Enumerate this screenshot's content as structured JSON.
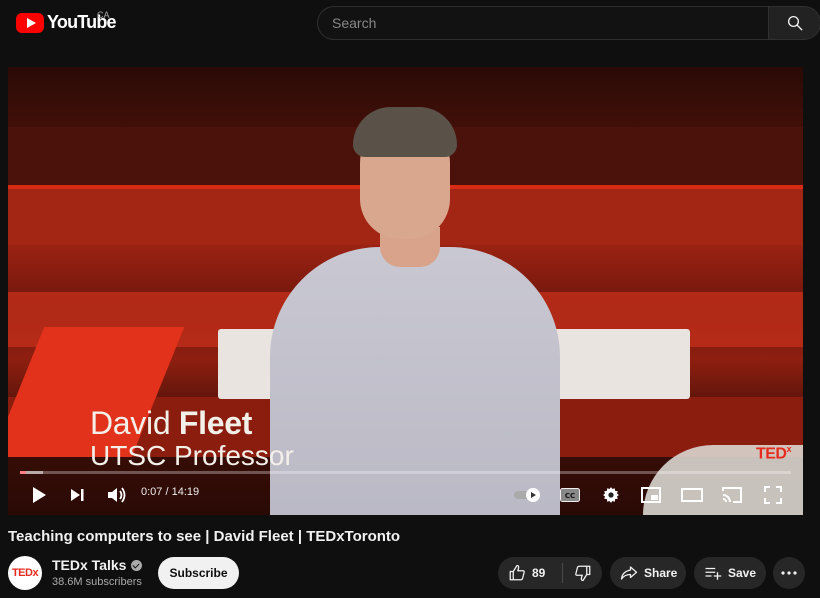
{
  "header": {
    "logo_text": "YouTube",
    "country_code": "CA",
    "search_placeholder": "Search",
    "search_icon": "search-icon"
  },
  "player": {
    "lower_third_first": "David",
    "lower_third_last": "Fleet",
    "lower_third_title": "UTSC Professor",
    "watermark": "TED",
    "watermark_sup": "x",
    "current_time": "0:07",
    "duration": "14:19",
    "time_display": "0:07 / 14:19",
    "progress_fraction": 0.008,
    "buffered_fraction": 0.03,
    "icons": [
      "play-icon",
      "next-icon",
      "volume-icon",
      "autoplay-toggle-icon",
      "captions-icon",
      "settings-icon",
      "miniplayer-icon",
      "theater-icon",
      "cast-icon",
      "fullscreen-icon"
    ],
    "accent_color": "#ff0000"
  },
  "video": {
    "title": "Teaching computers to see | David Fleet | TEDxToronto"
  },
  "channel": {
    "avatar_text": "TEDx",
    "name": "TEDx Talks",
    "subscribers": "38.6M subscribers",
    "subscribe_label": "Subscribe"
  },
  "actions": {
    "like_count": "89",
    "share_label": "Share",
    "save_label": "Save"
  }
}
